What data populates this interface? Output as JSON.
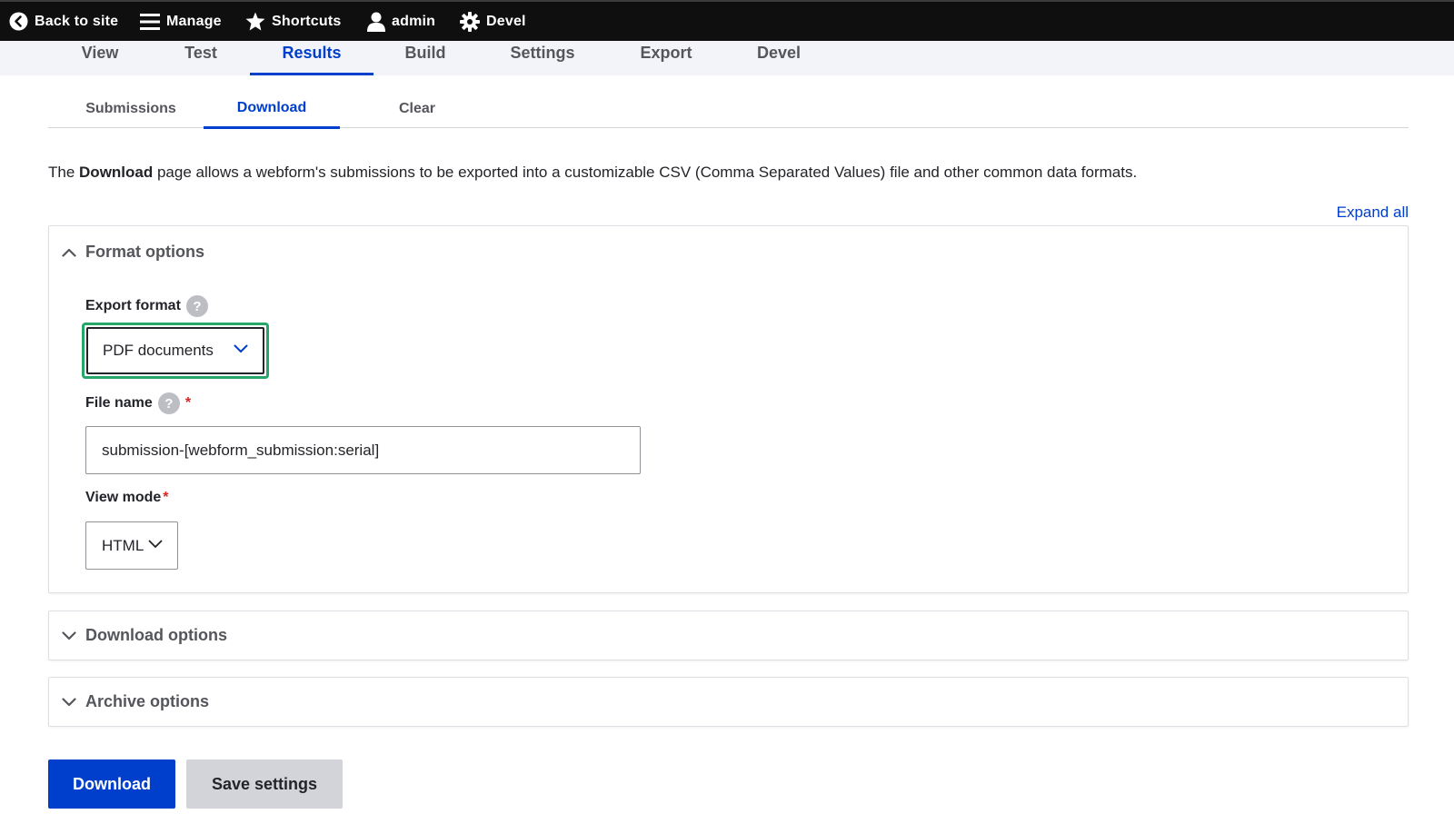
{
  "toolbar": {
    "back_label": "Back to site",
    "manage_label": "Manage",
    "shortcuts_label": "Shortcuts",
    "admin_label": "admin",
    "devel_label": "Devel"
  },
  "primary_tabs": [
    {
      "label": "View"
    },
    {
      "label": "Test"
    },
    {
      "label": "Results",
      "active": true
    },
    {
      "label": "Build"
    },
    {
      "label": "Settings"
    },
    {
      "label": "Export"
    },
    {
      "label": "Devel"
    }
  ],
  "secondary_tabs": [
    {
      "label": "Submissions"
    },
    {
      "label": "Download",
      "active": true
    },
    {
      "label": "Clear"
    }
  ],
  "description": {
    "prefix": "The ",
    "bold": "Download",
    "suffix": " page allows a webform's submissions to be exported into a customizable CSV (Comma Separated Values) file and other common data formats."
  },
  "expand_all_label": "Expand all",
  "format_options": {
    "title": "Format options",
    "export_format": {
      "label": "Export format",
      "value": "PDF documents",
      "help": "?"
    },
    "file_name": {
      "label": "File name",
      "value": "submission-[webform_submission:serial]",
      "help": "?",
      "required_marker": "*"
    },
    "view_mode": {
      "label": "View mode",
      "value": "HTML",
      "required_marker": "*"
    }
  },
  "download_options": {
    "title": "Download options"
  },
  "archive_options": {
    "title": "Archive options"
  },
  "buttons": {
    "download_label": "Download",
    "save_label": "Save settings"
  },
  "colors": {
    "accent": "#003ecc",
    "toolbar_bg": "#0f0f10",
    "focus_ring": "#26a769",
    "required": "#dc2323"
  }
}
